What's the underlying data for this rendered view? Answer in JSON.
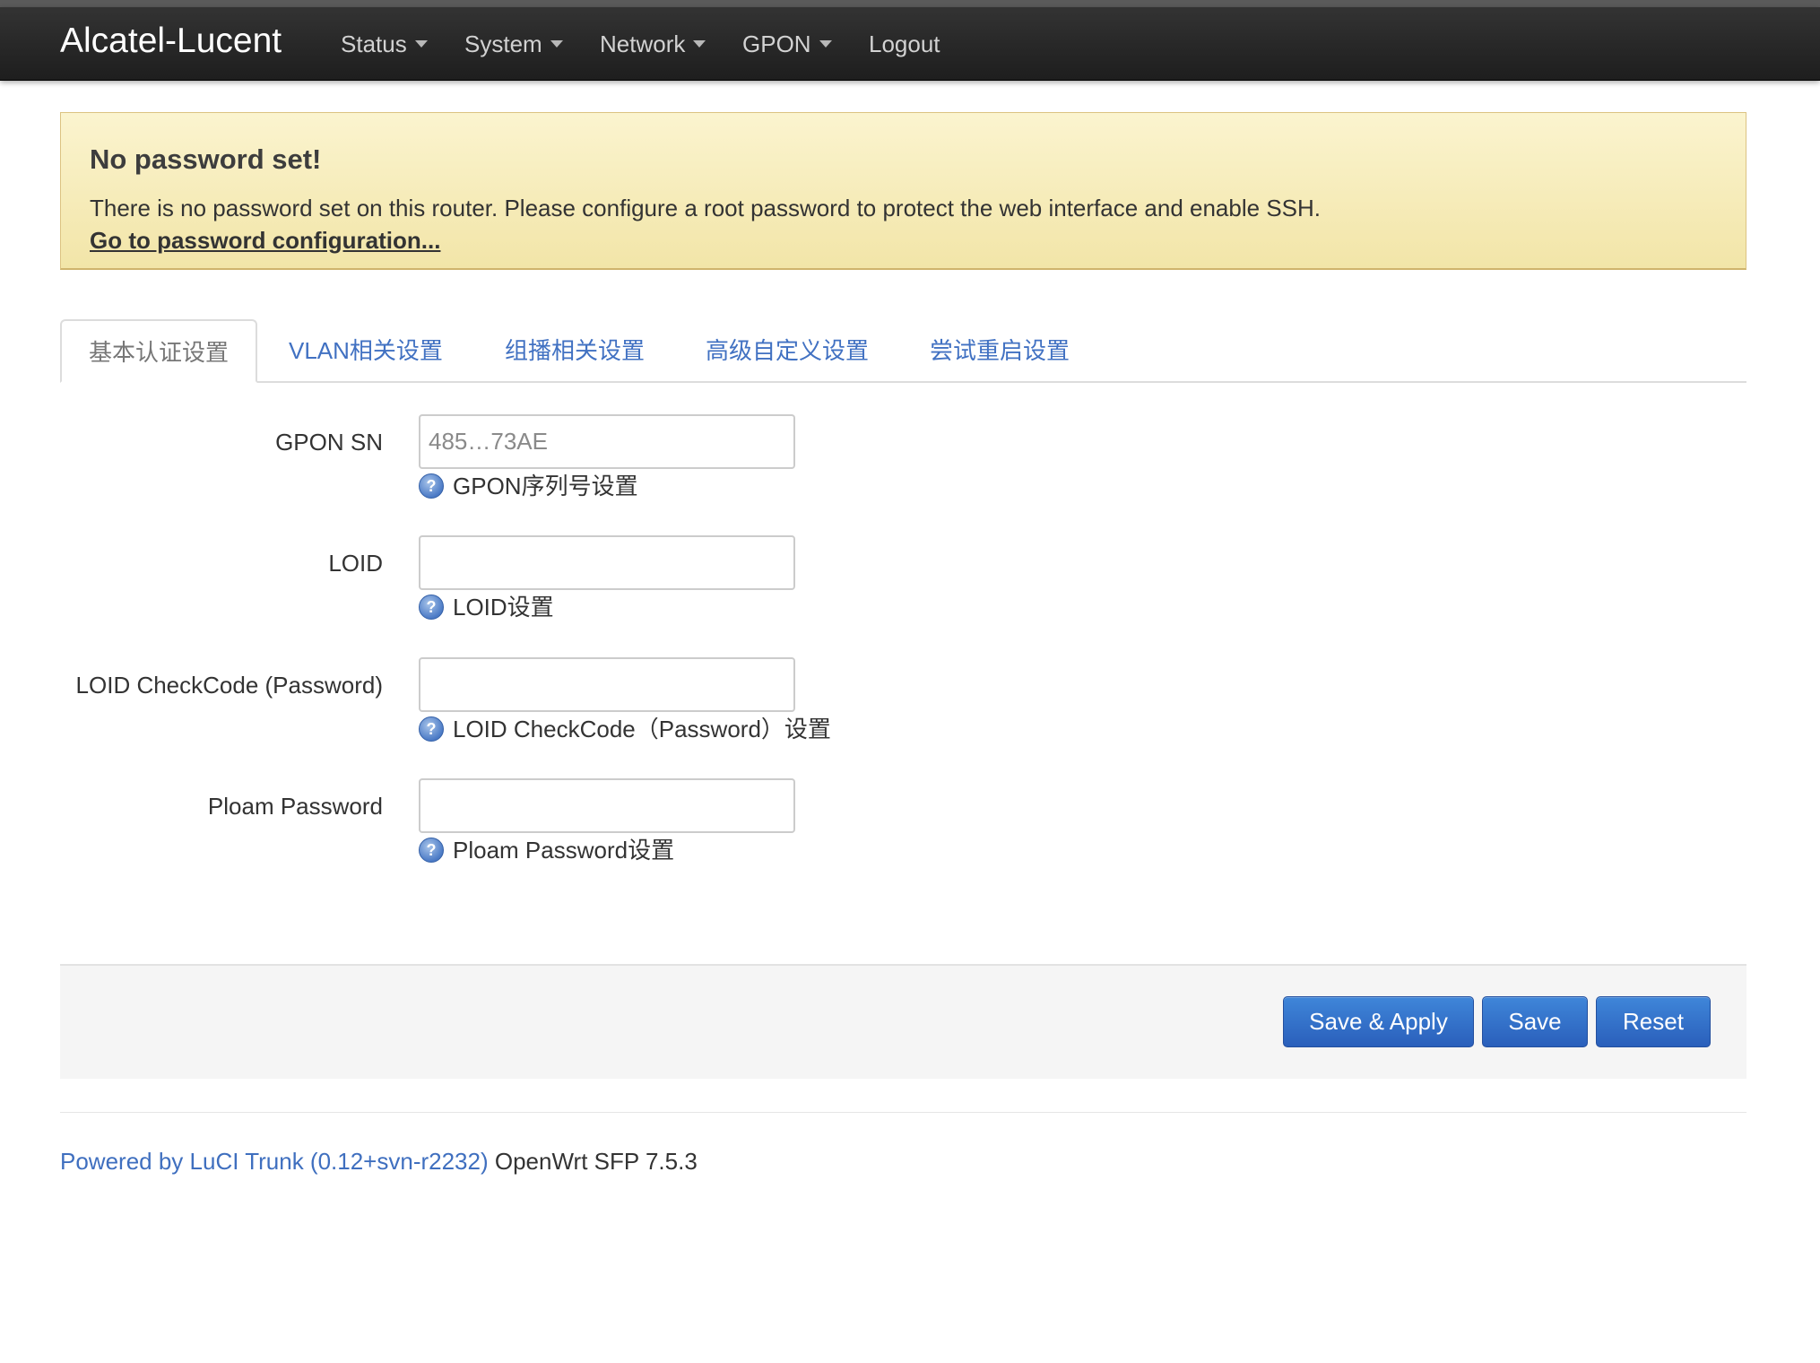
{
  "navbar": {
    "brand": "Alcatel-Lucent",
    "menu": [
      {
        "label": "Status",
        "has_dropdown": true
      },
      {
        "label": "System",
        "has_dropdown": true
      },
      {
        "label": "Network",
        "has_dropdown": true
      },
      {
        "label": "GPON",
        "has_dropdown": true
      },
      {
        "label": "Logout",
        "has_dropdown": false
      }
    ]
  },
  "alert": {
    "title": "No password set!",
    "message": "There is no password set on this router. Please configure a root password to protect the web interface and enable SSH.",
    "link": "Go to password configuration..."
  },
  "tabs": [
    {
      "label": "基本认证设置",
      "active": true
    },
    {
      "label": "VLAN相关设置",
      "active": false
    },
    {
      "label": "组播相关设置",
      "active": false
    },
    {
      "label": "高级自定义设置",
      "active": false
    },
    {
      "label": "尝试重启设置",
      "active": false
    }
  ],
  "form": {
    "fields": [
      {
        "label": "GPON SN",
        "value": "485…73AE",
        "help": "GPON序列号设置"
      },
      {
        "label": "LOID",
        "value": "",
        "help": "LOID设置"
      },
      {
        "label": "LOID CheckCode (Password)",
        "value": "",
        "help": "LOID CheckCode（Password）设置"
      },
      {
        "label": "Ploam Password",
        "value": "",
        "help": "Ploam Password设置"
      }
    ]
  },
  "actions": {
    "save_apply": "Save & Apply",
    "save": "Save",
    "reset": "Reset"
  },
  "footer": {
    "powered_by": "Powered by LuCI Trunk (0.12+svn-r2232)",
    "version": "OpenWrt SFP 7.5.3"
  },
  "colors": {
    "navbar": "#222222",
    "alert_bg": "#f7eebd",
    "link": "#4171c2",
    "button": "#3370cc"
  }
}
